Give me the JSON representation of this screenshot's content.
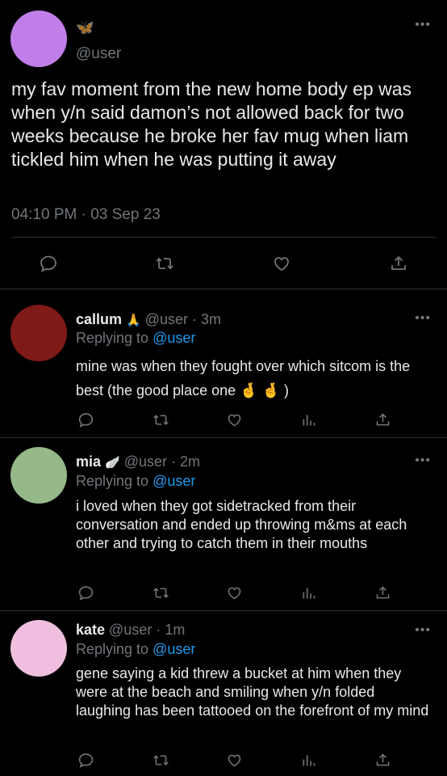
{
  "main_tweet": {
    "display_name_emoji": "🦋",
    "handle": "@user",
    "text": "my fav moment from the new home body ep was when y/n said damon’s not allowed back for two weeks because he broke her fav mug when liam tickled him when he was putting it away",
    "timestamp": "04:10 PM · 03 Sep 23",
    "more": "•••",
    "avatar_color": "#c07ee8"
  },
  "replies": [
    {
      "name": "callum",
      "emoji": "🙏",
      "handle_time": "@user · 3m",
      "replying_prefix": "Replying to ",
      "replying_to": "@user",
      "text": "mine was when they fought over which sitcom is the best (the good place one 🤞 🤞 )",
      "more": "•••",
      "avatar_color": "#7e1a17"
    },
    {
      "name": "mia",
      "emoji": "🪽",
      "handle_time": "@user · 2m",
      "replying_prefix": "Replying to ",
      "replying_to": "@user",
      "text": "i loved when they got sidetracked from their conversation and ended up throwing m&ms at each other and trying to catch them in their mouths",
      "more": "•••",
      "avatar_color": "#95b988"
    },
    {
      "name": "kate",
      "emoji": "",
      "handle_time": "@user · 1m",
      "replying_prefix": "Replying to ",
      "replying_to": "@user",
      "text": "gene saying a kid threw a bucket at him when they were at the beach and smiling when y/n folded laughing has been tattooed on the forefront of my mind",
      "more": "•••",
      "avatar_color": "#f0bfe0"
    }
  ],
  "colors": {
    "background": "#000000",
    "text": "#e7e9ea",
    "muted": "#71767b",
    "link": "#1d9bf0",
    "divider": "#2f3336"
  }
}
